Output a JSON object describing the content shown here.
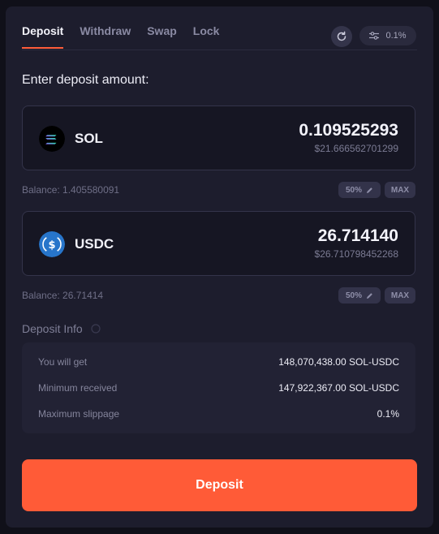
{
  "tabs": [
    {
      "label": "Deposit"
    },
    {
      "label": "Withdraw"
    },
    {
      "label": "Swap"
    },
    {
      "label": "Lock"
    }
  ],
  "toolbar": {
    "slippage_label": "0.1%"
  },
  "heading": "Enter deposit amount:",
  "token_a": {
    "symbol": "SOL",
    "amount": "0.109525293",
    "usd_value": "$21.666562701299",
    "balance": "Balance: 1.405580091",
    "half_label": "50%",
    "max_label": "MAX"
  },
  "token_b": {
    "symbol": "USDC",
    "amount": "26.714140",
    "usd_value": "$26.710798452268",
    "balance": "Balance: 26.71414",
    "half_label": "50%",
    "max_label": "MAX"
  },
  "info": {
    "title": "Deposit Info",
    "rows": [
      {
        "label": "You will get",
        "value": "148,070,438.00 SOL-USDC"
      },
      {
        "label": "Minimum received",
        "value": "147,922,367.00 SOL-USDC"
      },
      {
        "label": "Maximum slippage",
        "value": "0.1%"
      }
    ]
  },
  "deposit_button": "Deposit",
  "icons": {
    "refresh": "refresh-icon",
    "slippage": "sliders-icon",
    "sol": "solana-logo-icon",
    "usdc": "usdc-logo-icon",
    "info": "info-icon",
    "edit": "pencil-icon"
  },
  "colors": {
    "accent": "#ff5b37",
    "panel": "#1d1d2d",
    "usdc": "#2775ca"
  }
}
